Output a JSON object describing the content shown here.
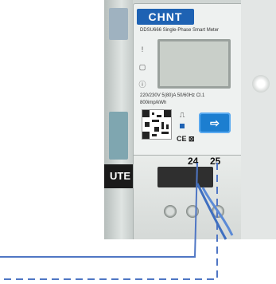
{
  "meter": {
    "brand": "CHNT",
    "model_line": "DDSU666   Single-Phase Smart Meter",
    "spec_line": "220/230V  5(80)A  50/60Hz  Cl.1",
    "impulse_line": "800imp/kWh",
    "cert_marks": "CE  ⊠",
    "button_glyph": "⇨",
    "pulse_glyph": "⎍"
  },
  "terminals": {
    "left_label": "24",
    "right_label": "25"
  },
  "breaker": {
    "label": "UTE"
  },
  "colors": {
    "wire_blue": "#4f76c4",
    "brand_blue": "#1e62b3"
  }
}
